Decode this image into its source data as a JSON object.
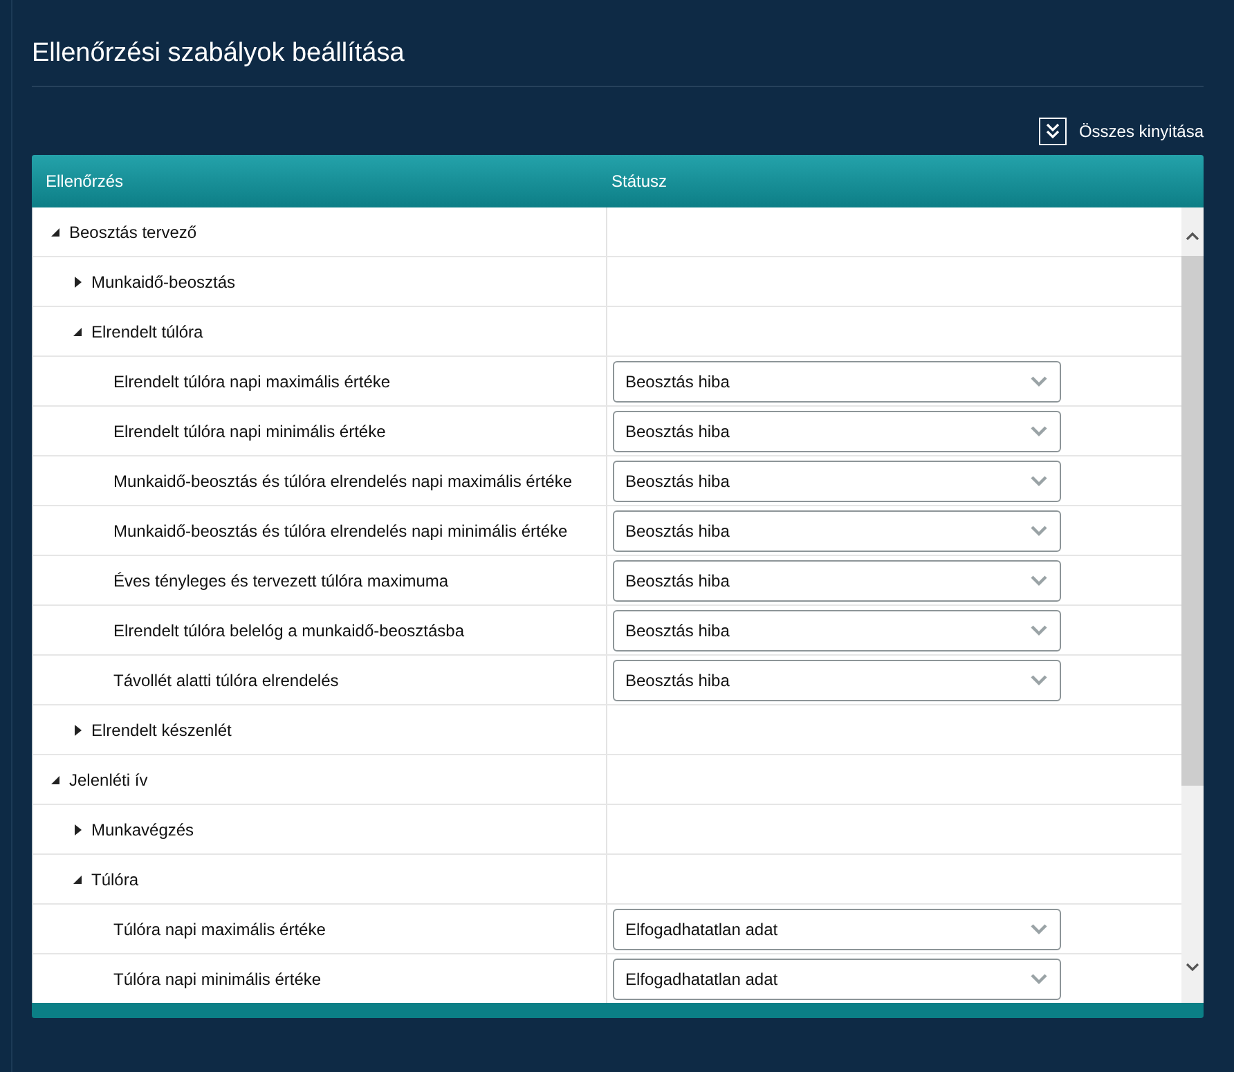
{
  "title": "Ellenőrzési szabályok beállítása",
  "expand_all": {
    "label": "Összes kinyitása"
  },
  "table": {
    "columns": [
      "Ellenőrzés",
      "Státusz"
    ],
    "rows": [
      {
        "label": "Beosztás tervező",
        "expanded": true,
        "children": [
          {
            "label": "Munkaidő-beosztás",
            "expanded": false
          },
          {
            "label": "Elrendelt túlóra",
            "expanded": true,
            "children": [
              {
                "label": "Elrendelt túlóra napi maximális értéke",
                "status": "Beosztás hiba"
              },
              {
                "label": "Elrendelt túlóra napi minimális értéke",
                "status": "Beosztás hiba"
              },
              {
                "label": "Munkaidő-beosztás és túlóra elrendelés napi maximális értéke",
                "status": "Beosztás hiba"
              },
              {
                "label": "Munkaidő-beosztás és túlóra elrendelés napi minimális értéke",
                "status": "Beosztás hiba"
              },
              {
                "label": "Éves tényleges és tervezett túlóra maximuma",
                "status": "Beosztás hiba"
              },
              {
                "label": "Elrendelt túlóra belelóg a munkaidő-beosztásba",
                "status": "Beosztás hiba"
              },
              {
                "label": "Távollét alatti túlóra elrendelés",
                "status": "Beosztás hiba"
              }
            ]
          },
          {
            "label": "Elrendelt készenlét",
            "expanded": false
          }
        ]
      },
      {
        "label": "Jelenléti ív",
        "expanded": true,
        "children": [
          {
            "label": "Munkavégzés",
            "expanded": false
          },
          {
            "label": "Túlóra",
            "expanded": true,
            "children": [
              {
                "label": "Túlóra napi maximális értéke",
                "status": "Elfogadhatatlan adat"
              },
              {
                "label": "Túlóra napi minimális értéke",
                "status": "Elfogadhatatlan adat"
              }
            ]
          }
        ]
      }
    ]
  }
}
